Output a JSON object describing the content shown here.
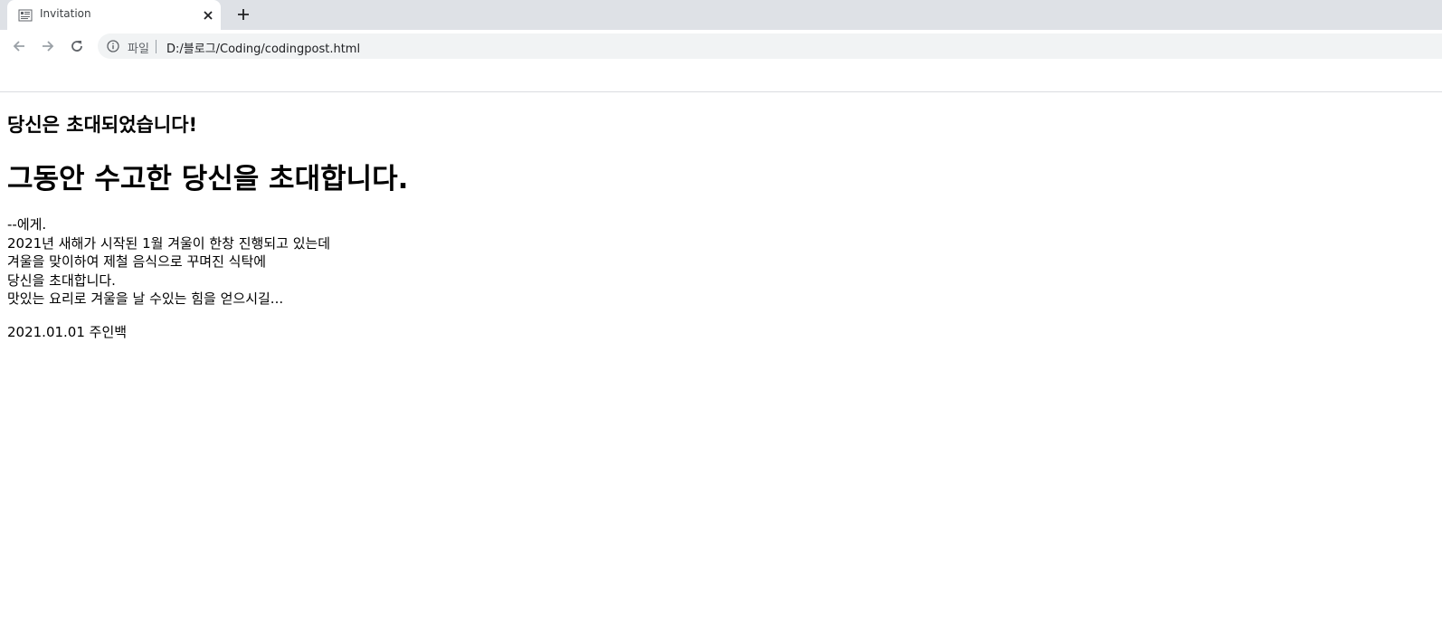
{
  "browser": {
    "tab": {
      "title": "Invitation",
      "favicon": "document-favicon-icon",
      "close_icon": "close-icon"
    },
    "new_tab_icon": "plus-icon",
    "toolbar": {
      "back_icon": "back-arrow-icon",
      "forward_icon": "forward-arrow-icon",
      "reload_icon": "reload-icon",
      "info_icon": "info-icon",
      "scheme_label": "파일",
      "url": "D:/블로그/Coding/codingpost.html"
    },
    "colors": {
      "tabstrip_bg": "#dee1e6",
      "omnibox_bg": "#f1f3f4",
      "inactive_nav": "#9aa0a6"
    }
  },
  "page": {
    "heading_small": "당신은 초대되었습니다!",
    "heading_large": "그동안 수고한 당신을 초대합니다.",
    "letter_lines": [
      "--에게.",
      "2021년 새해가 시작된 1월 겨울이 한창 진행되고 있는데",
      "겨울을 맞이하여 제철 음식으로 꾸며진 식탁에",
      "당신을 초대합니다.",
      "맛있는 요리로 겨울을 날 수있는 힘을 얻으시길..."
    ],
    "signature": "2021.01.01 주인백"
  }
}
